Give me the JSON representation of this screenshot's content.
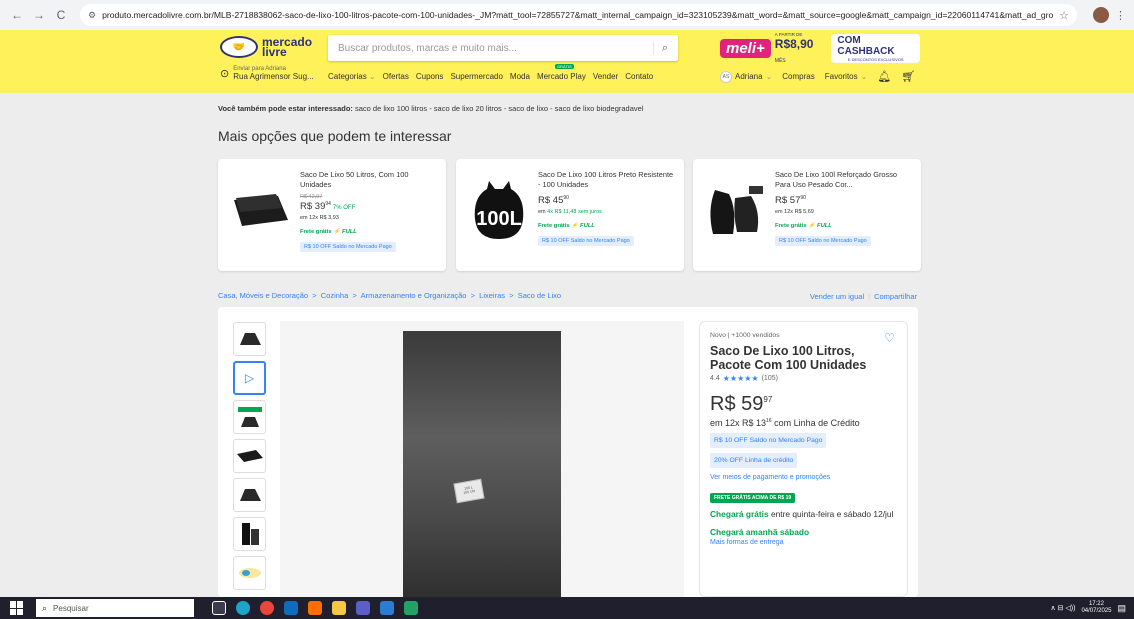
{
  "browser": {
    "url": "produto.mercadolivre.com.br/MLB-2718838062-saco-de-lixo-100-litros-pacote-com-100-unidades-_JM?matt_tool=72855727&matt_internal_campaign_id=323105239&matt_word=&matt_source=google&matt_campaign_id=22060114741&matt_ad_group_id=184...",
    "back_icon": "←",
    "forward_icon": "→",
    "reload_icon": "C"
  },
  "header": {
    "logo_line1": "mercado",
    "logo_line2": "livre",
    "search_placeholder": "Buscar produtos, marcas e muito mais...",
    "promo_brand": "meli+",
    "promo_from": "A PARTIR DE",
    "promo_price": "R$8,90",
    "promo_period": "MÊS",
    "cashback_big": "COM CASHBACK",
    "cashback_small": "E DESCONTOS EXCLUSIVOS",
    "location_small": "Enviar para Adriana",
    "location_address": "Rua Agrimensor Sug...",
    "nav": {
      "categorias": "Categorias",
      "ofertas": "Ofertas",
      "cupons": "Cupons",
      "supermercado": "Supermercado",
      "moda": "Moda",
      "mercado_play": "Mercado Play",
      "mercado_play_badge": "GRÁTIS",
      "vender": "Vender",
      "contato": "Contato"
    },
    "user_initials": "AS",
    "user_name": "Adriana",
    "compras": "Compras",
    "favoritos": "Favoritos"
  },
  "related": {
    "label": "Você também pode estar interessado:",
    "items": "saco de lixo 100 litros - saco de lixo 20 litros - saco de lixo - saco de lixo biodegradavel"
  },
  "more_options_title": "Mais opções que podem te interessar",
  "cards": [
    {
      "title": "Saco De Lixo 50 Litros, Com 100 Unidades",
      "old_price": "R$ 42,97",
      "price": "R$ 39",
      "cents": "94",
      "off": "7% OFF",
      "installment": "em 12x R$ 3,93",
      "installment_highlight": "",
      "free": "Frete grátis",
      "full": "⚡ FULL",
      "tag": "R$ 10 OFF Saldo no Mercado Pago"
    },
    {
      "title": "Saco De Lixo 100 Litros Preto Resistente - 100 Unidades",
      "old_price": "",
      "price": "R$ 45",
      "cents": "90",
      "off": "",
      "installment": "em ",
      "installment_highlight": "4x R$ 11,48 sem juros",
      "free": "Frete grátis",
      "full": "⚡ FULL",
      "tag": "R$ 10 OFF Saldo no Mercado Pago"
    },
    {
      "title": "Saco De Lixo 100l Reforçado Grosso Para Uso Pesado Cor...",
      "old_price": "",
      "price": "R$ 57",
      "cents": "90",
      "off": "",
      "installment": "em 12x R$ 5,69",
      "installment_highlight": "",
      "free": "Frete grátis",
      "full": "⚡ FULL",
      "tag": "R$ 10 OFF Saldo no Mercado Pago"
    }
  ],
  "breadcrumb": "Casa, Móveis e Decoração  >  Cozinha  >  Armazenamento e Organização  >  Lixeiras  >  Saco de Lixo",
  "sell_one": "Vender um igual",
  "share": "Compartilhar",
  "product": {
    "condition": "Novo  |  +1000 vendidos",
    "title": "Saco De Lixo 100 Litros, Pacote Com 100 Unidades",
    "rating": "4.4",
    "reviews": "(105)",
    "stars": "★★★★★",
    "price": "R$ 59",
    "cents": "97",
    "installment_prefix": "em 12x R$ 13",
    "installment_cents": "16",
    "installment_suffix": " com Linha de Crédito",
    "tag1": "R$ 10 OFF Saldo no Mercado Pago",
    "tag2": "20% OFF Linha de crédito",
    "payment_link": "Ver meios de pagamento e promoções",
    "free_badge": "FRETE GRÁTIS ACIMA DE R$ 19",
    "ship1_bold": "Chegará grátis",
    "ship1_rest": " entre quinta-feira e sábado 12/jul",
    "ship2_bold": "Chegará amanhã sábado",
    "more_delivery": "Mais formas de entrega",
    "bag_label": "100 L\n100 UN"
  },
  "taskbar": {
    "search": "Pesquisar",
    "time": "17:22",
    "date": "04/07/2025"
  },
  "colors": {
    "ml_yellow": "#fff159",
    "ml_blue": "#3483fa",
    "ml_green": "#00a650",
    "meli_pink": "#e0247d"
  }
}
